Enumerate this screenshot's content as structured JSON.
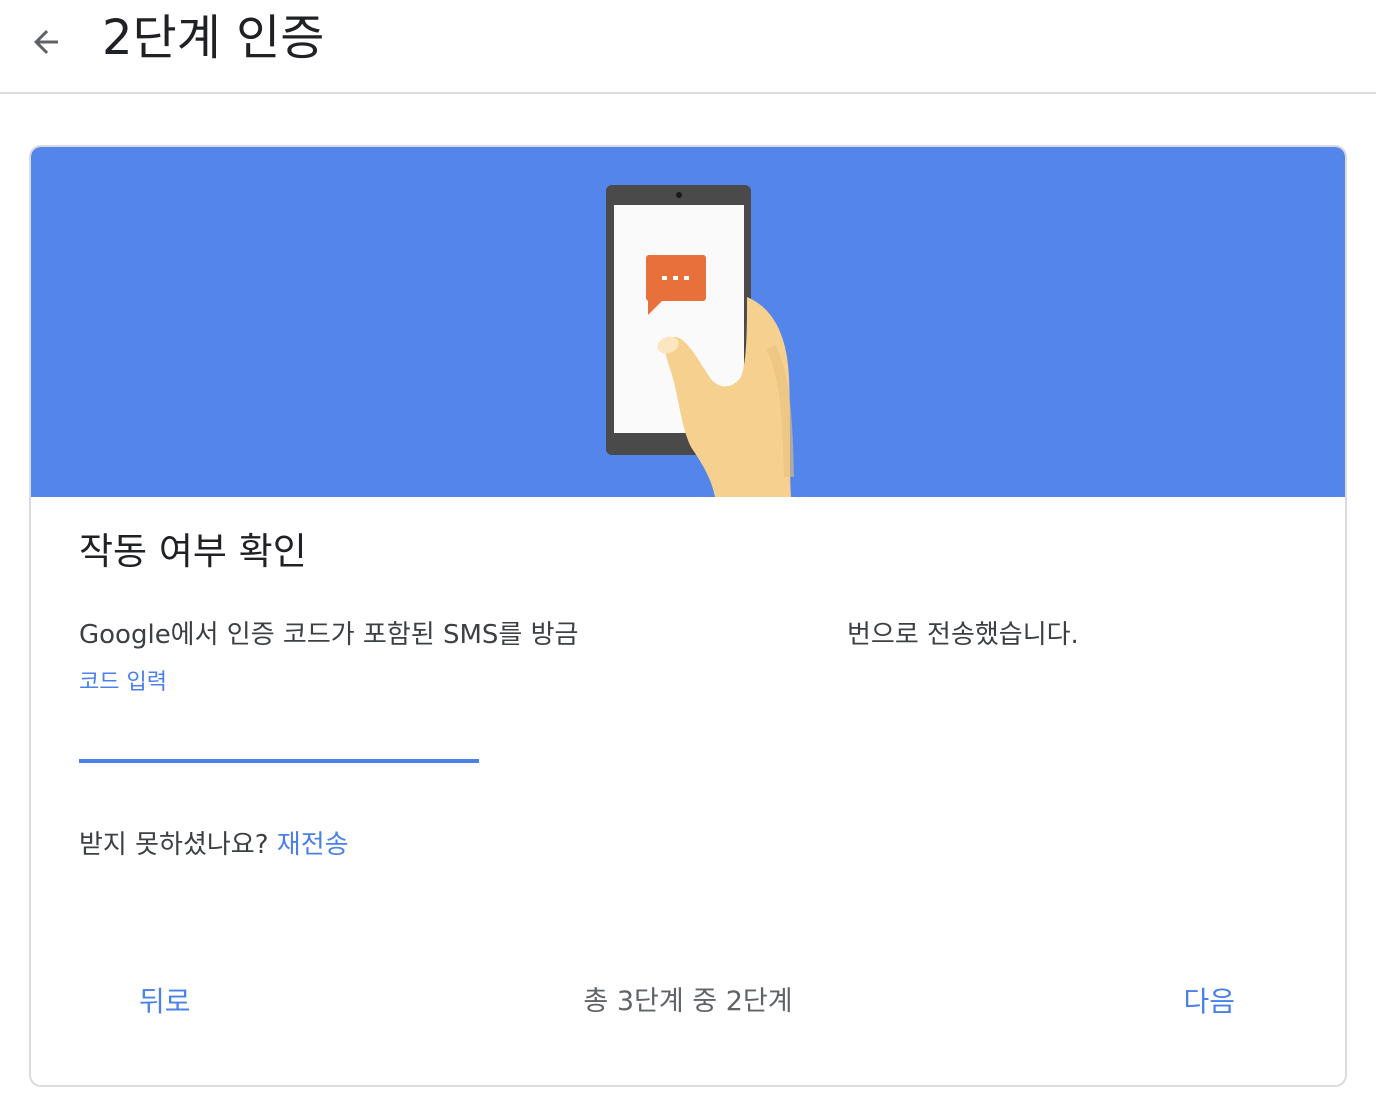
{
  "header": {
    "title": "2단계 인증",
    "back_icon": "arrow-back-icon"
  },
  "card": {
    "illustration": {
      "icon": "phone-sms-illustration",
      "message_icon": "chat-bubble-icon",
      "colors": {
        "background": "#5385eb",
        "bubble": "#e8703a",
        "phone": "#4a4a4a",
        "hand": "#f5d08e"
      }
    },
    "title": "작동 여부 확인",
    "description_part1": "Google에서 인증 코드가 포함된 SMS를 방금",
    "description_part2": "번으로 전송했습니다.",
    "code_label": "코드 입력",
    "code_value": "",
    "resend_prompt": "받지 못하셨나요?",
    "resend_link": "재전송"
  },
  "footer": {
    "back_label": "뒤로",
    "step_text": "총 3단계 중 2단계",
    "next_label": "다음"
  },
  "colors": {
    "accent": "#4a80e8",
    "border": "#dadce0"
  }
}
